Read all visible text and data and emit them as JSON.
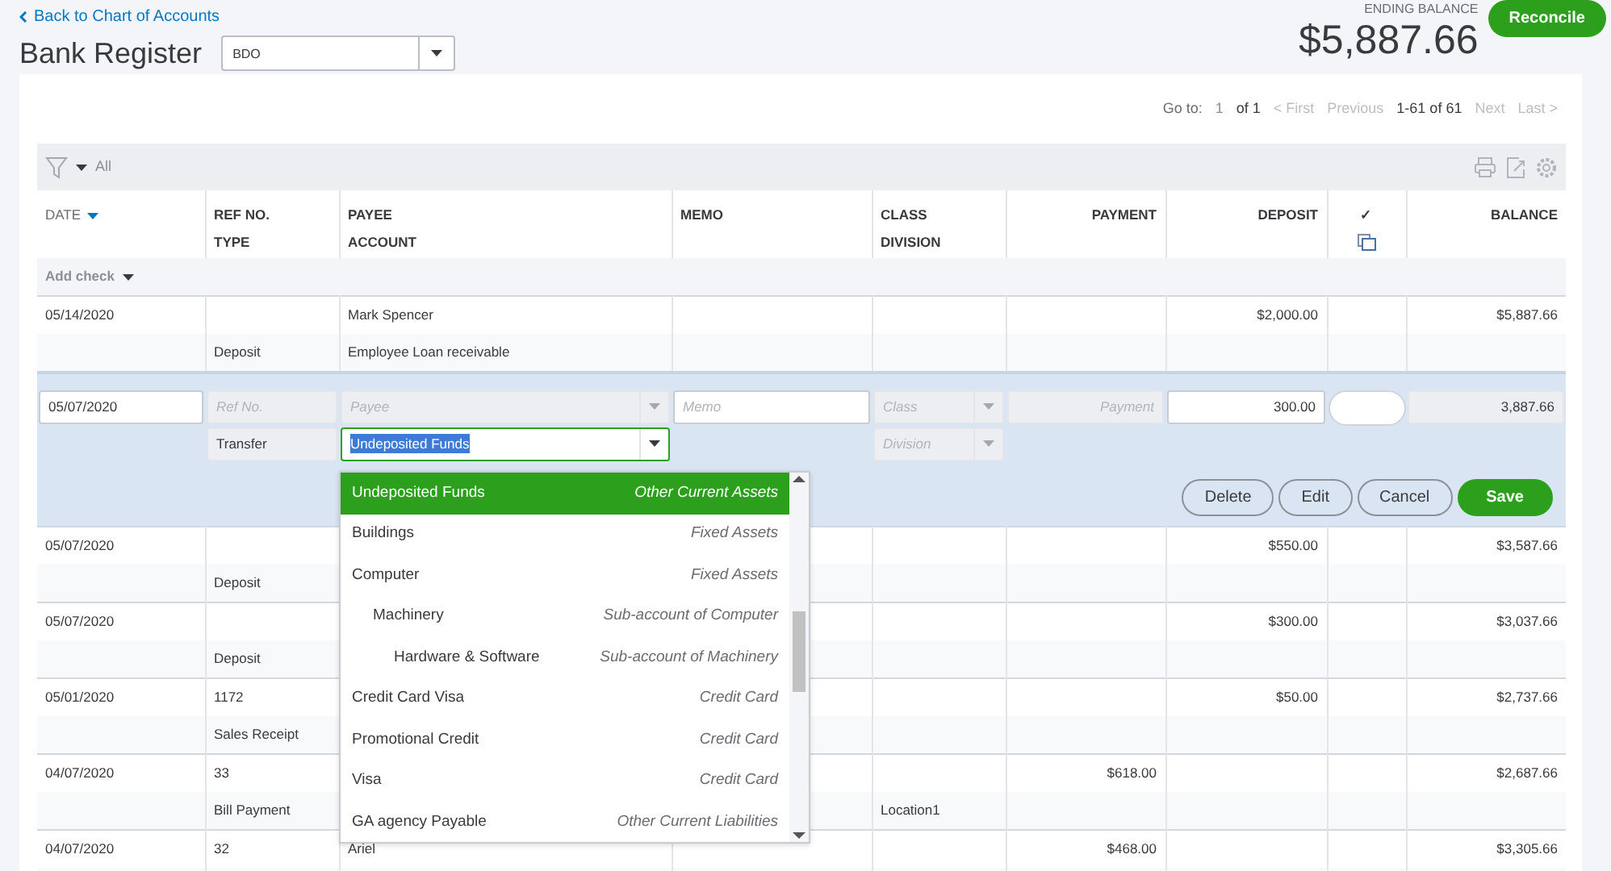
{
  "back_link": "Back to Chart of Accounts",
  "title": "Bank Register",
  "account_select": {
    "value": "BDO"
  },
  "ending_balance": {
    "label": "ENDING BALANCE",
    "amount": "$5,887.66"
  },
  "reconcile_button": "Reconcile",
  "pagination": {
    "go_to": "Go to:",
    "page": "1",
    "of": "of 1",
    "range": "1-61 of 61",
    "links_before": [
      {
        "label": "< First",
        "disabled": true
      },
      {
        "label": "Previous",
        "disabled": true
      }
    ],
    "links_after": [
      {
        "label": "Next",
        "disabled": true
      },
      {
        "label": "Last >",
        "disabled": true
      }
    ]
  },
  "filter": {
    "label": "All"
  },
  "columns": [
    {
      "label": "DATE",
      "sorted": true
    },
    {
      "label": "REF NO.",
      "sub_label": "TYPE",
      "sorted": false
    },
    {
      "label": "PAYEE",
      "sub_label": "ACCOUNT",
      "sorted": false
    },
    {
      "label": "MEMO",
      "sorted": false
    },
    {
      "label": "CLASS",
      "sub_label": "DIVISION",
      "sorted": false
    },
    {
      "label": "PAYMENT",
      "sorted": false
    },
    {
      "label": "DEPOSIT",
      "sorted": false
    },
    {
      "label": "✓",
      "sorted": false,
      "kind": "check"
    },
    {
      "label": "BALANCE",
      "sorted": false
    }
  ],
  "add_check": "Add check",
  "rows": [
    {
      "kind": "record",
      "date": "05/14/2020",
      "type": "Deposit",
      "payee": "Mark Spencer",
      "account": "Employee Loan receivable",
      "deposit": "$2,000.00",
      "balance": "$5,887.66"
    },
    {
      "kind": "editor",
      "date": "05/07/2020",
      "ref_no_placeholder": "Ref No.",
      "payee_placeholder": "Payee",
      "memo_placeholder": "Memo",
      "class_placeholder": "Class",
      "payment_placeholder": "Payment",
      "deposit": "300.00",
      "balance": "3,887.66",
      "type": "Transfer",
      "division_placeholder": "Division",
      "account": {
        "value": "Undeposited Funds",
        "text_selected": true,
        "items": [
          {
            "name": "Undeposited Funds",
            "type": "Other Current Assets",
            "selected": true
          },
          {
            "name": "Buildings",
            "type": "Fixed Assets",
            "selected": false
          },
          {
            "name": "Computer",
            "type": "Fixed Assets",
            "selected": false,
            "children": [
              {
                "name": "Machinery",
                "type": "Sub-account of Computer",
                "selected": false,
                "children": [
                  {
                    "name": "Hardware & Software",
                    "type": "Sub-account of Machinery",
                    "selected": false
                  }
                ]
              }
            ]
          },
          {
            "name": "Credit Card Visa",
            "type": "Credit Card",
            "selected": false
          },
          {
            "name": "Promotional Credit",
            "type": "Credit Card",
            "selected": false
          },
          {
            "name": "Visa",
            "type": "Credit Card",
            "selected": false
          },
          {
            "name": "GA agency Payable",
            "type": "Other Current Liabilities",
            "selected": false
          }
        ]
      },
      "buttons": [
        {
          "label": "Delete",
          "kind": "secondary"
        },
        {
          "label": "Edit",
          "kind": "secondary"
        },
        {
          "label": "Cancel",
          "kind": "secondary"
        },
        {
          "label": "Save",
          "kind": "primary"
        }
      ]
    },
    {
      "kind": "record",
      "date": "05/07/2020",
      "type": "Deposit",
      "deposit": "$550.00",
      "balance": "$3,587.66"
    },
    {
      "kind": "record",
      "date": "05/07/2020",
      "type": "Deposit",
      "deposit": "$300.00",
      "balance": "$3,037.66"
    },
    {
      "kind": "record",
      "date": "05/01/2020",
      "ref_no": "1172",
      "type": "Sales Receipt",
      "deposit": "$50.00",
      "balance": "$2,737.66"
    },
    {
      "kind": "record",
      "date": "04/07/2020",
      "ref_no": "33",
      "type": "Bill Payment",
      "division": "Location1",
      "payment": "$618.00",
      "balance": "$2,687.66"
    },
    {
      "kind": "record",
      "date": "04/07/2020",
      "ref_no": "32",
      "payee": "Ariel",
      "payment": "$468.00",
      "balance": "$3,305.66"
    }
  ]
}
